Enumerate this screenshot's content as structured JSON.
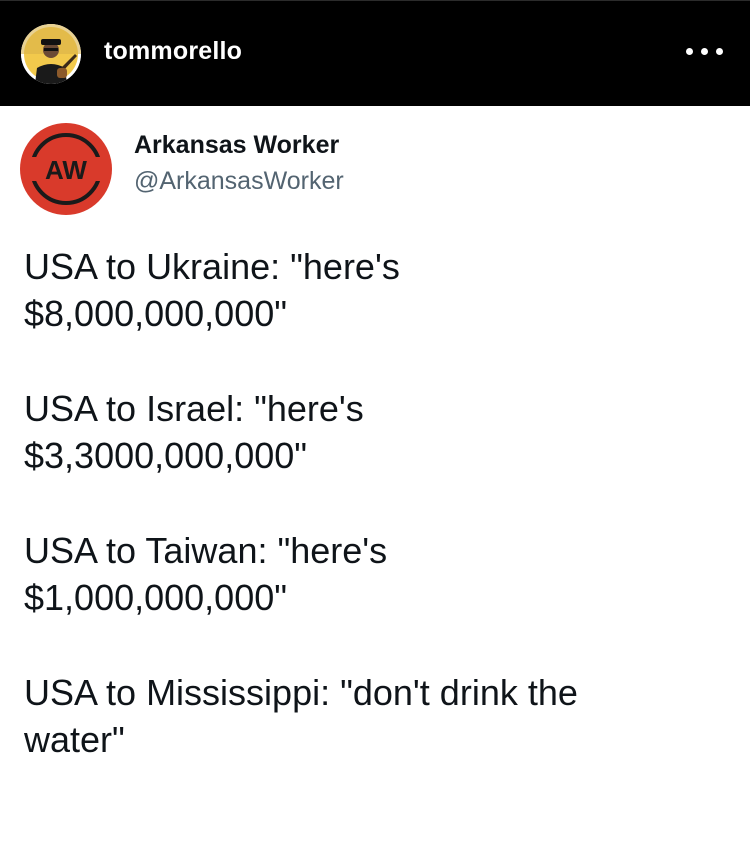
{
  "instagram_header": {
    "username": "tommorello",
    "avatar_icon": "profile-photo-guitarist",
    "more_icon": "more-options-dots-icon"
  },
  "tweet": {
    "author": {
      "name": "Arkansas Worker",
      "handle": "@ArkansasWorker",
      "logo_text": "AW",
      "logo_color": "#d93a2b"
    },
    "paragraphs": [
      {
        "line1": "USA to Ukraine: \"here's",
        "line2": "$8,000,000,000\""
      },
      {
        "line1": "USA to Israel: \"here's",
        "line2": "$3,3000,000,000\""
      },
      {
        "line1": "USA to Taiwan: \"here's",
        "line2": "$1,000,000,000\""
      },
      {
        "line1": "USA to Mississippi: \"don't drink the",
        "line2": "water\""
      }
    ]
  },
  "colors": {
    "header_bg": "#000000",
    "text_primary": "#0f1419",
    "text_secondary": "#536471"
  }
}
